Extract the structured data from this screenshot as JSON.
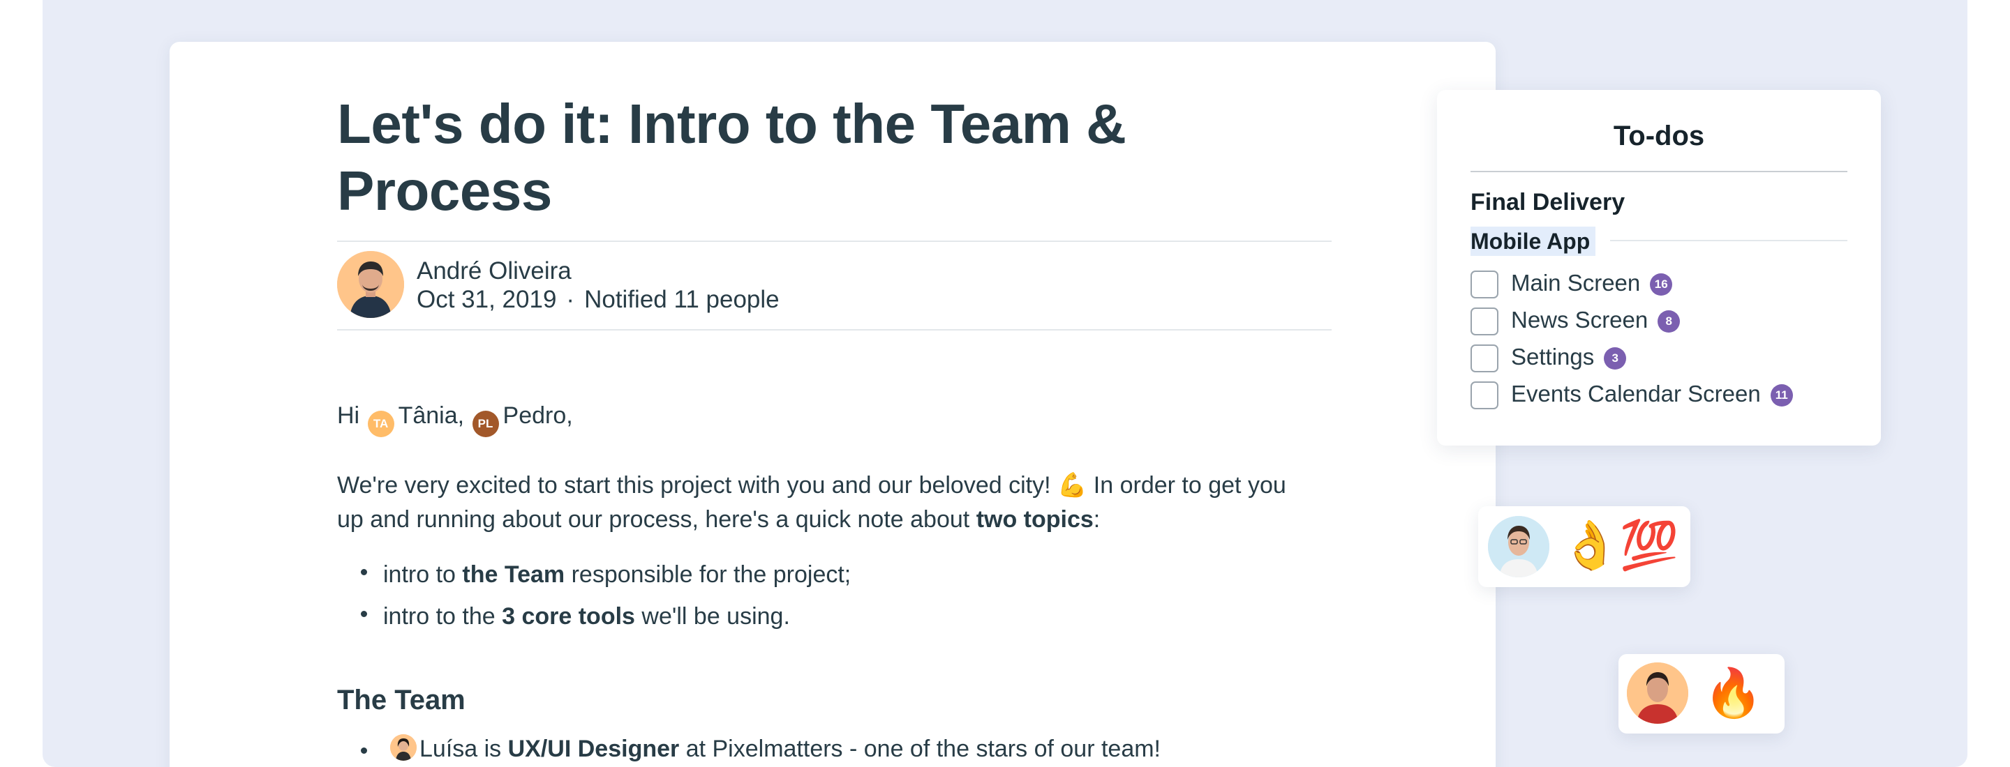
{
  "document": {
    "title": "Let's do it: Intro to the Team & Process",
    "author": "André Oliveira",
    "date": "Oct 31, 2019",
    "separator": "·",
    "notified": "Notified 11 people",
    "greeting_prefix": "Hi",
    "mentions": [
      {
        "initials": "TA",
        "name": "Tânia,",
        "color": "#ffb14e"
      },
      {
        "initials": "PL",
        "name": "Pedro,",
        "color": "#a2582a"
      }
    ],
    "intro_paragraph": {
      "part1": "We're very excited to start this project with you and our beloved city! ",
      "emoji": "💪",
      "part2": " In order to get you up and running about our process, here's a quick note about ",
      "bold": "two topics",
      "part3": ":"
    },
    "bullets": [
      {
        "before": "intro to ",
        "bold": "the Team",
        "after": " responsible for the project;"
      },
      {
        "before": "intro to the ",
        "bold": "3 core tools",
        "after": " we'll be using."
      }
    ],
    "section_heading": "The Team",
    "team_bullet": {
      "name": "Luísa is ",
      "bold": "UX/UI Designer",
      "after": " at Pixelmatters - one of the stars of our team!"
    }
  },
  "todos": {
    "title": "To-dos",
    "group": "Final Delivery",
    "subgroup": "Mobile App",
    "items": [
      {
        "label": "Main Screen",
        "count": "16"
      },
      {
        "label": "News Screen",
        "count": "8"
      },
      {
        "label": "Settings",
        "count": "3"
      },
      {
        "label": "Events Calendar Screen",
        "count": "11"
      }
    ]
  },
  "reactions": [
    {
      "emojis": "👌💯"
    },
    {
      "emojis": "🔥"
    }
  ],
  "colors": {
    "background": "#e8ecf7",
    "text": "#283c46",
    "badge": "#7b5fb0",
    "highlight": "#e3edfb"
  }
}
